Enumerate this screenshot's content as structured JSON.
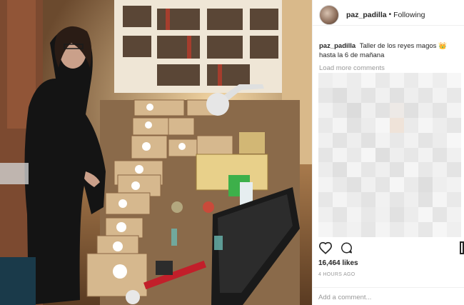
{
  "post": {
    "username": "paz_padilla",
    "separator": "•",
    "follow_status": "Following",
    "caption_user": "paz_padilla",
    "caption_text": "Taller de los reyes magos 👑 hasta la 6 de mañana",
    "load_more": "Load more comments",
    "likes": "16,464 likes",
    "time": "4 HOURS AGO",
    "add_comment_placeholder": "Add a comment..."
  },
  "icons": {
    "like": "heart-icon",
    "comment": "comment-icon",
    "save": "bookmark-icon",
    "avatar": "profile-avatar"
  },
  "colors": {
    "text": "#262626",
    "muted": "#999999",
    "border": "#efefef"
  }
}
